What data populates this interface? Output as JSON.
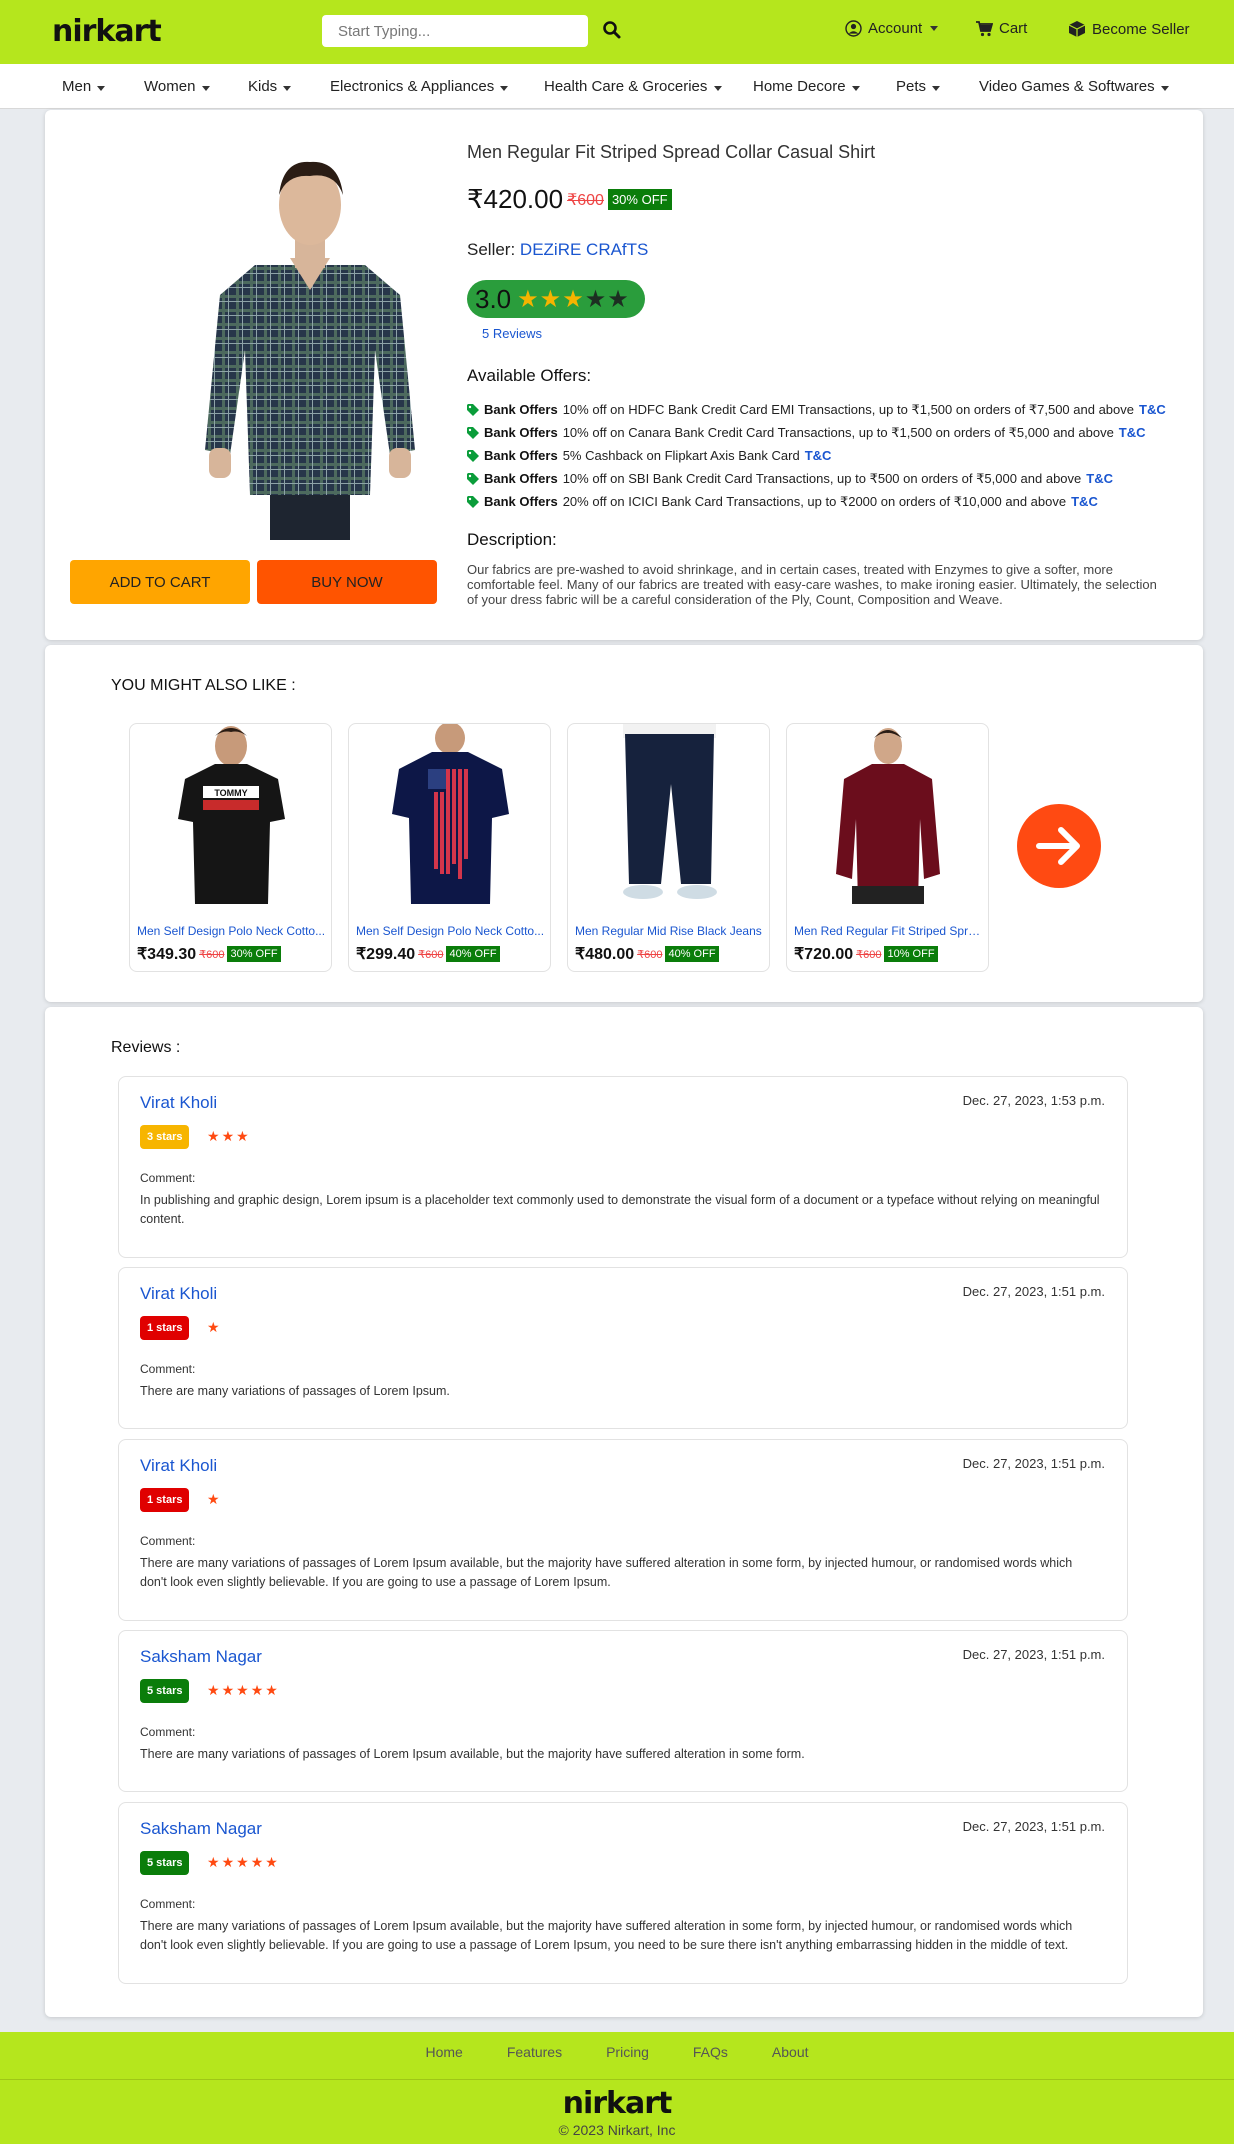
{
  "header": {
    "logo": "nirkart",
    "search_placeholder": "Start Typing...",
    "account_label": "Account",
    "cart_label": "Cart",
    "seller_label": "Become Seller"
  },
  "categories": [
    "Men",
    "Women",
    "Kids",
    "Electronics & Appliances",
    "Health Care & Groceries",
    "Home Decore",
    "Pets",
    "Video Games & Softwares"
  ],
  "product": {
    "title": "Men Regular Fit Striped Spread Collar Casual Shirt",
    "price": "₹420.00",
    "mrp": "₹600",
    "discount": "30% OFF",
    "seller_label": "Seller:",
    "seller_name": "DEZiRE CRAfTS",
    "rating": "3.0",
    "rating_value": 3,
    "rating_max": 5,
    "reviews_link": "5 Reviews",
    "add_to_cart": "ADD TO CART",
    "buy_now": "BUY NOW",
    "offers_heading": "Available Offers:",
    "offers": [
      {
        "bold": "Bank Offers",
        "text": "10% off on HDFC Bank Credit Card EMI Transactions, up to ₹1,500 on orders of ₹7,500 and above",
        "tc": "T&C"
      },
      {
        "bold": "Bank Offers",
        "text": "10% off on Canara Bank Credit Card Transactions, up to ₹1,500 on orders of ₹5,000 and above",
        "tc": "T&C"
      },
      {
        "bold": "Bank Offers",
        "text": "5% Cashback on Flipkart Axis Bank Card",
        "tc": "T&C"
      },
      {
        "bold": "Bank Offers",
        "text": "10% off on SBI Bank Credit Card Transactions, up to ₹500 on orders of ₹5,000 and above",
        "tc": "T&C"
      },
      {
        "bold": "Bank Offers",
        "text": "20% off on ICICI Bank Card Transactions, up to ₹2000 on orders of ₹10,000 and above",
        "tc": "T&C"
      }
    ],
    "description_heading": "Description:",
    "description": "Our fabrics are pre-washed to avoid shrinkage, and in certain cases, treated with Enzymes to give a softer, more comfortable feel. Many of our fabrics are treated with easy-care washes, to make ironing easier. Ultimately, the selection of your dress fabric will be a careful consideration of the Ply, Count, Composition and Weave."
  },
  "also_like": {
    "heading": "YOU MIGHT ALSO LIKE :",
    "items": [
      {
        "name": "Men Self Design Polo Neck Cotto...",
        "price": "₹349.30",
        "mrp": "₹600",
        "discount": "30% OFF",
        "image": "black-tshirt-image"
      },
      {
        "name": "Men Self Design Polo Neck Cotto...",
        "price": "₹299.40",
        "mrp": "₹600",
        "discount": "40% OFF",
        "image": "navy-flag-tshirt-image"
      },
      {
        "name": "Men Regular Mid Rise Black Jeans",
        "price": "₹480.00",
        "mrp": "₹600",
        "discount": "40% OFF",
        "image": "jeans-image"
      },
      {
        "name": "Men Red Regular Fit Striped Spre...",
        "price": "₹720.00",
        "mrp": "₹600",
        "discount": "10% OFF",
        "image": "maroon-shirt-image"
      }
    ],
    "next_icon": "arrow-right-icon"
  },
  "reviews": {
    "heading": "Reviews :",
    "comment_label": "Comment:",
    "items": [
      {
        "name": "Virat Kholi",
        "date": "Dec. 27, 2023, 1:53 p.m.",
        "badge": "3 stars",
        "stars": 3,
        "badge_color": "#f7b500",
        "comment": "In publishing and graphic design, Lorem ipsum is a placeholder text commonly used to demonstrate the visual form of a document or a typeface without relying on meaningful content."
      },
      {
        "name": "Virat Kholi",
        "date": "Dec. 27, 2023, 1:51 p.m.",
        "badge": "1 stars",
        "stars": 1,
        "badge_color": "#e00000",
        "comment": "There are many variations of passages of Lorem Ipsum."
      },
      {
        "name": "Virat Kholi",
        "date": "Dec. 27, 2023, 1:51 p.m.",
        "badge": "1 stars",
        "stars": 1,
        "badge_color": "#e00000",
        "comment": "There are many variations of passages of Lorem Ipsum available, but the majority have suffered alteration in some form, by injected humour, or randomised words which don't look even slightly believable. If you are going to use a passage of Lorem Ipsum."
      },
      {
        "name": "Saksham Nagar",
        "date": "Dec. 27, 2023, 1:51 p.m.",
        "badge": "5 stars",
        "stars": 5,
        "badge_color": "#0a7d0a",
        "comment": "There are many variations of passages of Lorem Ipsum available, but the majority have suffered alteration in some form."
      },
      {
        "name": "Saksham Nagar",
        "date": "Dec. 27, 2023, 1:51 p.m.",
        "badge": "5 stars",
        "stars": 5,
        "badge_color": "#0a7d0a",
        "comment": "There are many variations of passages of Lorem Ipsum available, but the majority have suffered alteration in some form, by injected humour, or randomised words which don't look even slightly believable. If you are going to use a passage of Lorem Ipsum, you need to be sure there isn't anything embarrassing hidden in the middle of text."
      }
    ]
  },
  "footer": {
    "links": [
      "Home",
      "Features",
      "Pricing",
      "FAQs",
      "About"
    ],
    "logo": "nirkart",
    "copyright": "© 2023 Nirkart, Inc"
  },
  "colors": {
    "brand": "#b5e61d",
    "cart_button": "#ffa500",
    "buy_button": "#ff5400",
    "link": "#1a56d0",
    "discount": "#0a7d0a"
  }
}
